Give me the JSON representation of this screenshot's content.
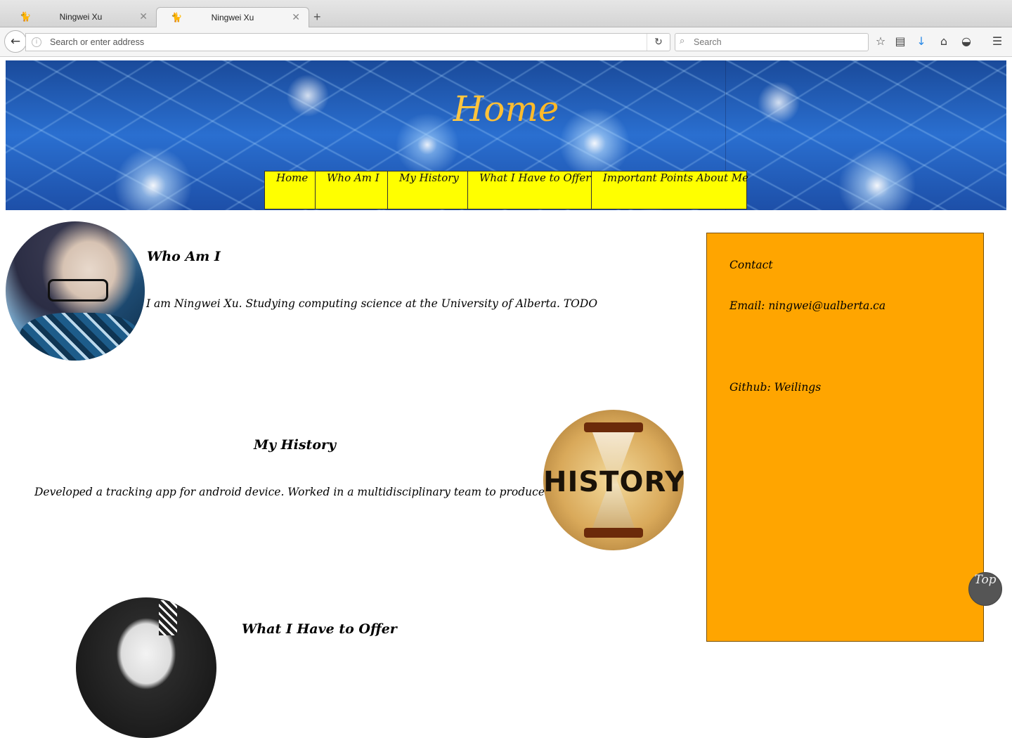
{
  "browser": {
    "tabs": [
      {
        "title": "Ningwei Xu",
        "active": false
      },
      {
        "title": "Ningwei Xu",
        "active": true
      }
    ],
    "address_placeholder": "Search or enter address",
    "search_placeholder": "Search"
  },
  "page": {
    "title": "Home",
    "menu": [
      "Home",
      "Who Am I",
      "My History",
      "What I Have to Offer",
      "Important Points About Me"
    ],
    "who": {
      "heading": "Who Am I",
      "text": "I am Ningwei Xu. Studying computing science at the University of Alberta. TODO"
    },
    "history": {
      "heading": "My History",
      "text": "Developed a tracking app for android device. Worked in a multidisciplinary team to produce an game. TODO",
      "image_text": "HISTORY"
    },
    "offer": {
      "heading": "What I Have to Offer"
    },
    "sidebar": {
      "contact": "Contact",
      "email": "Email: ningwei@ualberta.ca",
      "github": "Github: Weilings"
    },
    "top_button": "Top"
  },
  "colors": {
    "menu_bg": "#ffff00",
    "sidebar_bg": "#ffa500"
  }
}
